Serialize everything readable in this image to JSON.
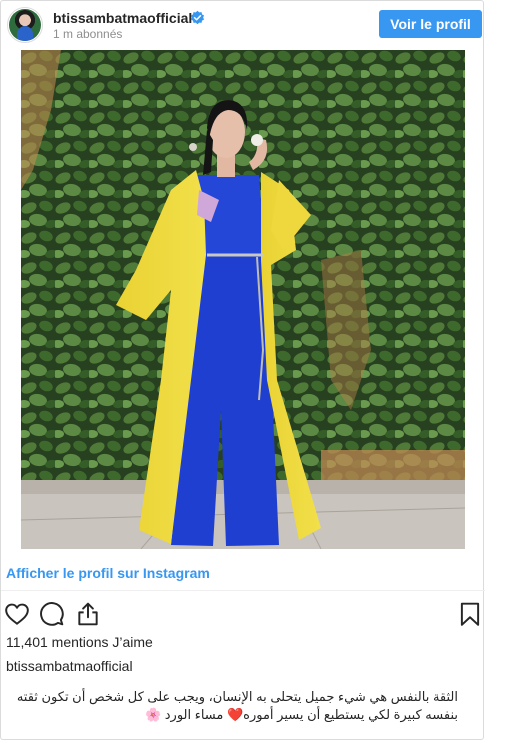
{
  "header": {
    "username": "btissambatmaofficial",
    "followers": "1 m abonnés",
    "view_profile_label": "Voir le profil"
  },
  "post": {
    "view_on_instagram_label": "Afficher le profil sur Instagram",
    "likes": "11,401 mentions J’aime",
    "caption_username": "btissambatmaofficial",
    "caption_text": "الثقة بالنفس هي شيء جميل يتحلى به الإنسان، ويجب على كل شخص أن تكون ثقته بنفسه كبيرة لكي يستطيع أن يسير أموره❤️ مساء الورد 🌸"
  },
  "icons": {
    "verified": "verified-badge-icon",
    "like": "heart-icon",
    "comment": "comment-bubble-icon",
    "share": "share-icon",
    "save": "bookmark-icon"
  },
  "colors": {
    "accent": "#3897f0",
    "verified": "#3897f0",
    "text": "#262626",
    "muted": "#8e8e8e",
    "border": "#dbdbdb"
  }
}
